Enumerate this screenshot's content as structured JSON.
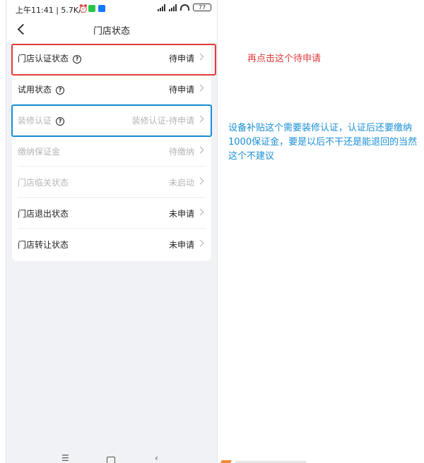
{
  "status_bar": {
    "time": "上午11:41 | 5.7K/s",
    "alarm_icon": "alarm-icon",
    "battery": "77"
  },
  "nav": {
    "title": "门店状态",
    "back_icon": "chevron-left-icon"
  },
  "rows": [
    {
      "label": "门店认证状态",
      "has_help": true,
      "value": "待申请",
      "disabled": false
    },
    {
      "label": "试用状态",
      "has_help": true,
      "value": "待申请",
      "disabled": false
    },
    {
      "label": "装修认证",
      "has_help": true,
      "value": "装修认证-待申请",
      "disabled": true
    },
    {
      "label": "缴纳保证金",
      "has_help": false,
      "value": "待缴纳",
      "disabled": true
    },
    {
      "label": "门店临关状态",
      "has_help": false,
      "value": "未启动",
      "disabled": true
    },
    {
      "label": "门店退出状态",
      "has_help": false,
      "value": "未申请",
      "disabled": false
    },
    {
      "label": "门店转让状态",
      "has_help": false,
      "value": "未申请",
      "disabled": false
    }
  ],
  "annotations": {
    "red_note": "再点击这个待申请",
    "blue_note": "设备补贴这个需要装修认证，认证后还要缴纳1000保证金，要是以后不干还是能退回的当然这个不建议",
    "red_color": "#e23b3b",
    "blue_color": "#1a8fd6"
  },
  "bottom_nav": {
    "menu": "☰",
    "back": "‹"
  }
}
